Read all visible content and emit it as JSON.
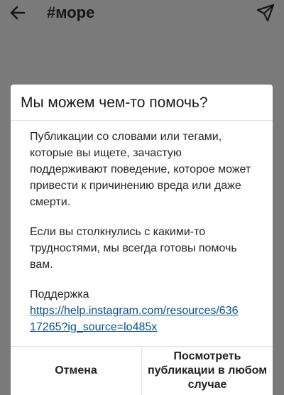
{
  "header": {
    "title": "#море",
    "back_icon": "arrow-left-icon",
    "send_icon": "send-icon"
  },
  "dialog": {
    "title": "Мы можем чем-то помочь?",
    "paragraph_1": "Публикации со словами или тегами, которые вы ищете, зачастую поддерживают поведение, которое может привести к причинению вреда или даже смерти.",
    "paragraph_2": "Если вы столкнулись с какими-то трудностями, мы всегда готовы помочь вам.",
    "support_label": "Поддержка",
    "support_link": "https://help.instagram.com/resources/63617265?ig_source=lo485x",
    "cancel_label": "Отмена",
    "view_label": "Посмотреть публикации в любом случае"
  },
  "colors": {
    "overlay": "#7a7a7a",
    "link": "#0b4f8c"
  }
}
